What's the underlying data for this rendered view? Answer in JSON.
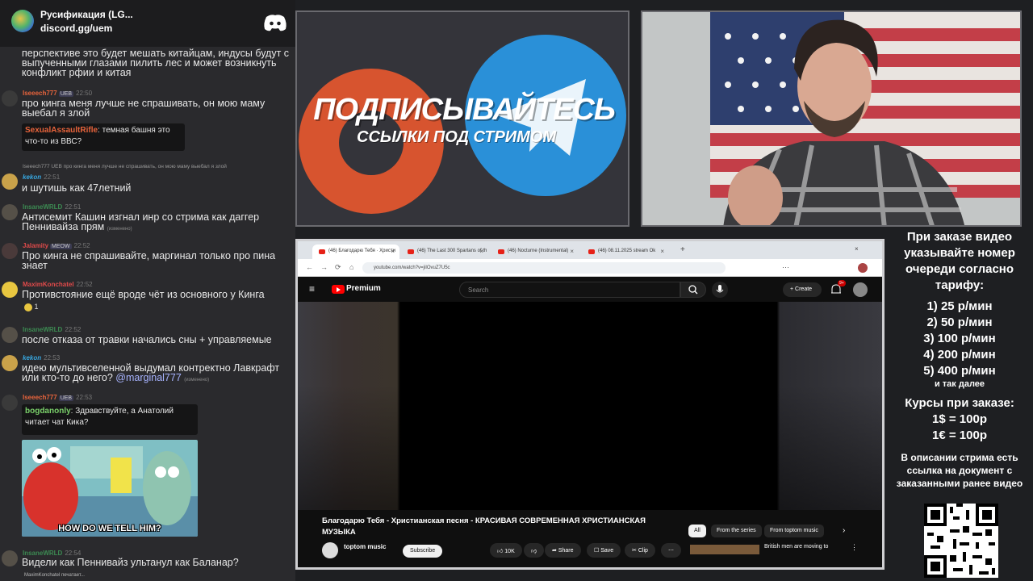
{
  "discord": {
    "title": "Русификация (LG...",
    "invite": "discord.gg/uem"
  },
  "chat": {
    "m0_text": "перспективе это будет мешать китайцам, индусы будут с выпученными глазами пилить лес и может возникнуть конфликт рфии и китая",
    "m1": {
      "name": "Iseeech777",
      "badge": "UEB",
      "time": "22:50",
      "text": "про кинга меня лучше не спрашивать, он мою маму выебал я злой"
    },
    "m2": {
      "name": "SexualAssaultRifle",
      "text": "темная башня это что-то из ВВС?"
    },
    "m3": {
      "reply": "Iseeech777 UEB про кинга меня лучше не спрашивать, он мою маму выебал я злой",
      "name": "kekon",
      "time": "22:51",
      "text": "и шутишь как 47летний"
    },
    "m4": {
      "name": "InsaneWRLD",
      "time": "22:51",
      "text": "Антисемит Кашин изгнал инр со стрима как даггер Пеннивайза прям",
      "edited": "(изменено)"
    },
    "m5": {
      "name": "Jalamity",
      "badge": "MEOW",
      "time": "22:52",
      "text": "Про кинга не спрашивайте, маргинал только про пина знает"
    },
    "m6": {
      "name": "MaximKonchatel",
      "time": "22:52",
      "text": "Противстояние ещё вроде чёт из основного у Кинга",
      "reaction": "1"
    },
    "m7": {
      "name": "InsaneWRLD",
      "time": "22:52",
      "text": "после отказа от травки начались сны + управляемые"
    },
    "m8": {
      "name": "kekon",
      "time": "22:53",
      "text": "идею мультивселенной выдумал контректно Лавкрафт или кто-то до него?",
      "mention": "@marginal777",
      "edited": "(изменено)"
    },
    "m9": {
      "name": "Iseeech777",
      "badge": "UEB",
      "time": "22:53",
      "quote_name": "bogdanonly",
      "quote_text": "Здравствуйте, а Анатолий читает чат Кика?",
      "meme_caption": "HOW DO WE TELL HIM?"
    },
    "m10": {
      "name": "InsaneWRLD",
      "time": "22:54",
      "text": "Видели как Пеннивайз ультанул как Баланар?"
    },
    "typing": "MaximKonchatel печатает..."
  },
  "promo": {
    "big": "ПОДПИСЫВАЙТЕСЬ",
    "small": "ССЫЛКИ ПОД СТРИМОМ"
  },
  "browser": {
    "tabs": [
      "(46) Благодарю Тебя · Христи",
      "(46) The Last 300 Spartans of th",
      "(46) Nocturne (Instrumental)",
      "(46) 08.11.2025 stream Ok"
    ],
    "url": "youtube.com/watch?v=jiIOvuZ7U5c",
    "brand": "Premium",
    "search_placeholder": "Search",
    "create": "Create",
    "notif": "9+",
    "video_title": "Благодарю Тебя - Христианская песня - КРАСИВАЯ СОВРЕМЕННАЯ ХРИСТИАНСКАЯ МУЗЫКА",
    "chips": [
      "All",
      "From the series",
      "From toptom music"
    ],
    "channel": "toptom music",
    "subscribe": "Subscribe",
    "likes": "10K",
    "share": "Share",
    "save": "Save",
    "clip": "Clip",
    "rec_title": "British men are moving to"
  },
  "info": {
    "l1": "При заказе видео указывайте номер очереди согласно тарифу:",
    "rates": [
      "1) 25 р/мин",
      "2) 50 р/мин",
      "3) 100 р/мин",
      "4) 200 р/мин",
      "5) 400 р/мин"
    ],
    "etc": "и так далее",
    "courses": "Курсы при заказе:",
    "usd": "1$ = 100р",
    "eur": "1€ = 100р",
    "desc": "В описании стрима есть ссылка на документ с заказанными ранее видео"
  }
}
